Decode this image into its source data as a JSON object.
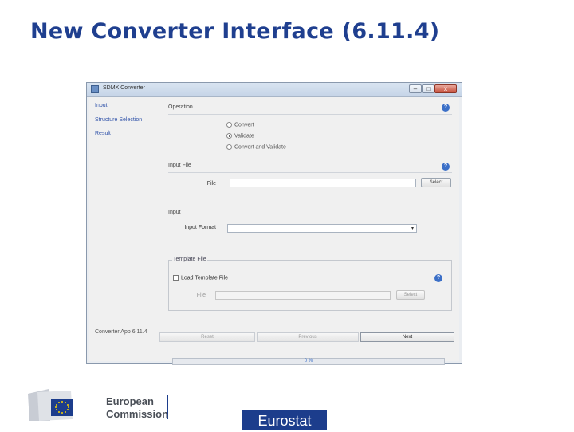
{
  "slide": {
    "title": "New Converter Interface (6.11.4)"
  },
  "window": {
    "title": "SDMX Converter",
    "minimize_label": "–",
    "maximize_label": "□",
    "close_label": "x"
  },
  "nav": {
    "items": [
      {
        "label": "Input",
        "active": true
      },
      {
        "label": "Structure Selection",
        "active": false
      },
      {
        "label": "Result",
        "active": false
      }
    ],
    "version": "Converter App 6.11.4"
  },
  "operation": {
    "label": "Operation",
    "options": [
      {
        "label": "Convert",
        "selected": false
      },
      {
        "label": "Validate",
        "selected": true
      },
      {
        "label": "Convert and Validate",
        "selected": false
      }
    ]
  },
  "input_file": {
    "label": "Input File",
    "file_label": "File",
    "file_value": "",
    "select_button": "Select"
  },
  "input": {
    "label": "Input",
    "format_label": "Input Format",
    "format_value": ""
  },
  "template_file": {
    "label": "Template File",
    "checkbox_label": "Load Template File",
    "checked": false,
    "file_label": "File",
    "file_value": "",
    "select_button": "Select"
  },
  "navigation": {
    "reset": "Reset",
    "previous": "Previous",
    "next": "Next"
  },
  "progress": {
    "value": 0,
    "text": "0 %"
  },
  "footer": {
    "ec_logo_text_line1": "European",
    "ec_logo_text_line2": "Commission",
    "eurostat_label": "Eurostat"
  },
  "colors": {
    "title": "#1f3f8f",
    "help_icon": "#3b6fc7",
    "eurostat_bg": "#1c3d8c",
    "progress_fill": "#6fa3d9"
  }
}
